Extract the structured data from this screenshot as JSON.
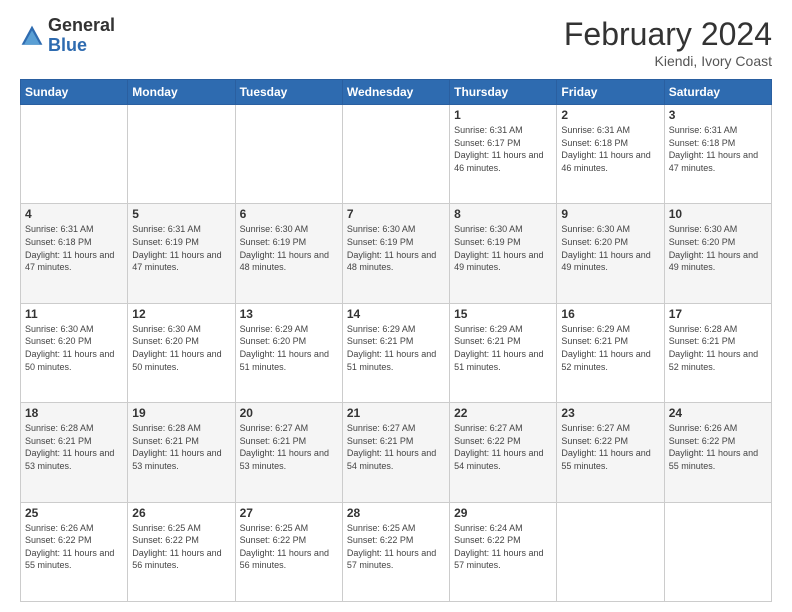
{
  "logo": {
    "general": "General",
    "blue": "Blue"
  },
  "header": {
    "month": "February 2024",
    "location": "Kiendi, Ivory Coast"
  },
  "days_of_week": [
    "Sunday",
    "Monday",
    "Tuesday",
    "Wednesday",
    "Thursday",
    "Friday",
    "Saturday"
  ],
  "weeks": [
    [
      {
        "day": "",
        "info": ""
      },
      {
        "day": "",
        "info": ""
      },
      {
        "day": "",
        "info": ""
      },
      {
        "day": "",
        "info": ""
      },
      {
        "day": "1",
        "info": "Sunrise: 6:31 AM\nSunset: 6:17 PM\nDaylight: 11 hours and 46 minutes."
      },
      {
        "day": "2",
        "info": "Sunrise: 6:31 AM\nSunset: 6:18 PM\nDaylight: 11 hours and 46 minutes."
      },
      {
        "day": "3",
        "info": "Sunrise: 6:31 AM\nSunset: 6:18 PM\nDaylight: 11 hours and 47 minutes."
      }
    ],
    [
      {
        "day": "4",
        "info": "Sunrise: 6:31 AM\nSunset: 6:18 PM\nDaylight: 11 hours and 47 minutes."
      },
      {
        "day": "5",
        "info": "Sunrise: 6:31 AM\nSunset: 6:19 PM\nDaylight: 11 hours and 47 minutes."
      },
      {
        "day": "6",
        "info": "Sunrise: 6:30 AM\nSunset: 6:19 PM\nDaylight: 11 hours and 48 minutes."
      },
      {
        "day": "7",
        "info": "Sunrise: 6:30 AM\nSunset: 6:19 PM\nDaylight: 11 hours and 48 minutes."
      },
      {
        "day": "8",
        "info": "Sunrise: 6:30 AM\nSunset: 6:19 PM\nDaylight: 11 hours and 49 minutes."
      },
      {
        "day": "9",
        "info": "Sunrise: 6:30 AM\nSunset: 6:20 PM\nDaylight: 11 hours and 49 minutes."
      },
      {
        "day": "10",
        "info": "Sunrise: 6:30 AM\nSunset: 6:20 PM\nDaylight: 11 hours and 49 minutes."
      }
    ],
    [
      {
        "day": "11",
        "info": "Sunrise: 6:30 AM\nSunset: 6:20 PM\nDaylight: 11 hours and 50 minutes."
      },
      {
        "day": "12",
        "info": "Sunrise: 6:30 AM\nSunset: 6:20 PM\nDaylight: 11 hours and 50 minutes."
      },
      {
        "day": "13",
        "info": "Sunrise: 6:29 AM\nSunset: 6:20 PM\nDaylight: 11 hours and 51 minutes."
      },
      {
        "day": "14",
        "info": "Sunrise: 6:29 AM\nSunset: 6:21 PM\nDaylight: 11 hours and 51 minutes."
      },
      {
        "day": "15",
        "info": "Sunrise: 6:29 AM\nSunset: 6:21 PM\nDaylight: 11 hours and 51 minutes."
      },
      {
        "day": "16",
        "info": "Sunrise: 6:29 AM\nSunset: 6:21 PM\nDaylight: 11 hours and 52 minutes."
      },
      {
        "day": "17",
        "info": "Sunrise: 6:28 AM\nSunset: 6:21 PM\nDaylight: 11 hours and 52 minutes."
      }
    ],
    [
      {
        "day": "18",
        "info": "Sunrise: 6:28 AM\nSunset: 6:21 PM\nDaylight: 11 hours and 53 minutes."
      },
      {
        "day": "19",
        "info": "Sunrise: 6:28 AM\nSunset: 6:21 PM\nDaylight: 11 hours and 53 minutes."
      },
      {
        "day": "20",
        "info": "Sunrise: 6:27 AM\nSunset: 6:21 PM\nDaylight: 11 hours and 53 minutes."
      },
      {
        "day": "21",
        "info": "Sunrise: 6:27 AM\nSunset: 6:21 PM\nDaylight: 11 hours and 54 minutes."
      },
      {
        "day": "22",
        "info": "Sunrise: 6:27 AM\nSunset: 6:22 PM\nDaylight: 11 hours and 54 minutes."
      },
      {
        "day": "23",
        "info": "Sunrise: 6:27 AM\nSunset: 6:22 PM\nDaylight: 11 hours and 55 minutes."
      },
      {
        "day": "24",
        "info": "Sunrise: 6:26 AM\nSunset: 6:22 PM\nDaylight: 11 hours and 55 minutes."
      }
    ],
    [
      {
        "day": "25",
        "info": "Sunrise: 6:26 AM\nSunset: 6:22 PM\nDaylight: 11 hours and 55 minutes."
      },
      {
        "day": "26",
        "info": "Sunrise: 6:25 AM\nSunset: 6:22 PM\nDaylight: 11 hours and 56 minutes."
      },
      {
        "day": "27",
        "info": "Sunrise: 6:25 AM\nSunset: 6:22 PM\nDaylight: 11 hours and 56 minutes."
      },
      {
        "day": "28",
        "info": "Sunrise: 6:25 AM\nSunset: 6:22 PM\nDaylight: 11 hours and 57 minutes."
      },
      {
        "day": "29",
        "info": "Sunrise: 6:24 AM\nSunset: 6:22 PM\nDaylight: 11 hours and 57 minutes."
      },
      {
        "day": "",
        "info": ""
      },
      {
        "day": "",
        "info": ""
      }
    ]
  ]
}
